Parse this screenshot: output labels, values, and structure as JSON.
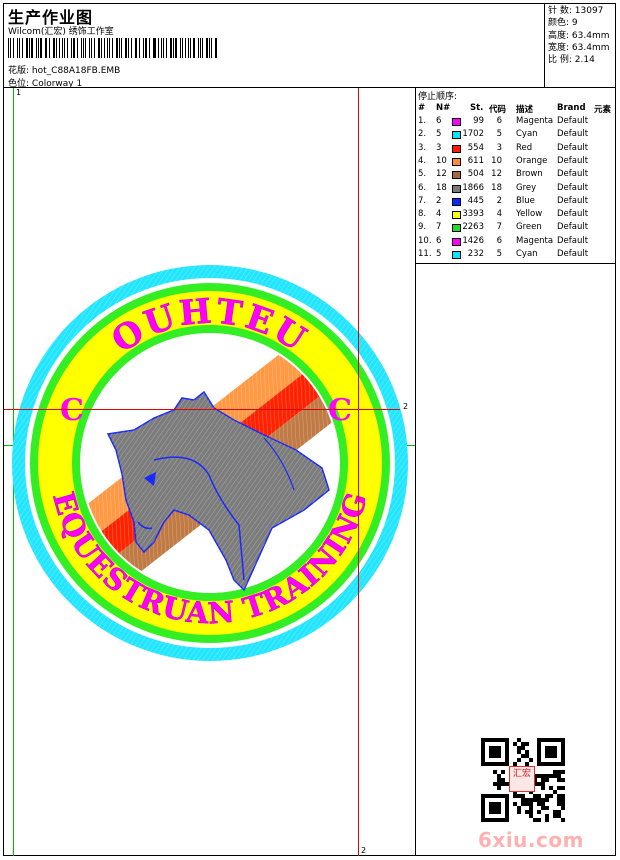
{
  "header": {
    "title": "生产作业图",
    "studio": "Wilcom(汇宏) 绣饰工作室",
    "file_label": "花版:",
    "file_value": "hot_C88A18FB.EMB",
    "colorway_label": "色位:",
    "colorway_value": "Colorway 1"
  },
  "stats": {
    "stitches_label": "针 数:",
    "stitches_value": "13097",
    "colors_label": "颜色:",
    "colors_value": "9",
    "height_label": "高度:",
    "height_value": "63.4mm",
    "width_label": "宽度:",
    "width_value": "63.4mm",
    "scale_label": "比 例:",
    "scale_value": "2.14"
  },
  "sequence": {
    "title": "停止顺序:",
    "headers": {
      "num": "#",
      "n": "N#",
      "st": "St.",
      "code": "代码",
      "desc": "描述",
      "brand": "Brand",
      "elem": "元素"
    },
    "rows": [
      {
        "num": "1.",
        "n": "6",
        "st": "99",
        "code": "6",
        "desc": "Magenta",
        "brand": "Default",
        "color": "#ff00ff"
      },
      {
        "num": "2.",
        "n": "5",
        "st": "1702",
        "code": "5",
        "desc": "Cyan",
        "brand": "Default",
        "color": "#00e8ff"
      },
      {
        "num": "3.",
        "n": "3",
        "st": "554",
        "code": "3",
        "desc": "Red",
        "brand": "Default",
        "color": "#ff1a00"
      },
      {
        "num": "4.",
        "n": "10",
        "st": "611",
        "code": "10",
        "desc": "Orange",
        "brand": "Default",
        "color": "#ff8c3a"
      },
      {
        "num": "5.",
        "n": "12",
        "st": "504",
        "code": "12",
        "desc": "Brown",
        "brand": "Default",
        "color": "#a86a3a"
      },
      {
        "num": "6.",
        "n": "18",
        "st": "1866",
        "code": "18",
        "desc": "Grey",
        "brand": "Default",
        "color": "#7a7a7a"
      },
      {
        "num": "7.",
        "n": "2",
        "st": "445",
        "code": "2",
        "desc": "Blue",
        "brand": "Default",
        "color": "#0a2aff"
      },
      {
        "num": "8.",
        "n": "4",
        "st": "3393",
        "code": "4",
        "desc": "Yellow",
        "brand": "Default",
        "color": "#ffff00"
      },
      {
        "num": "9.",
        "n": "7",
        "st": "2263",
        "code": "7",
        "desc": "Green",
        "brand": "Default",
        "color": "#22dd22"
      },
      {
        "num": "10.",
        "n": "6",
        "st": "1426",
        "code": "6",
        "desc": "Magenta",
        "brand": "Default",
        "color": "#ff00ff"
      },
      {
        "num": "11.",
        "n": "5",
        "st": "232",
        "code": "5",
        "desc": "Cyan",
        "brand": "Default",
        "color": "#00e8ff"
      }
    ]
  },
  "design": {
    "top_text": "OUHTEU",
    "bottom_text": "EQUESTRUAN TRAINING",
    "left_letter": "C",
    "right_letter": "C"
  },
  "markers": {
    "green_v": "1",
    "red_h": "2",
    "red_v": "2"
  },
  "watermark": "6xiu.com",
  "seal_text": "汇宏"
}
